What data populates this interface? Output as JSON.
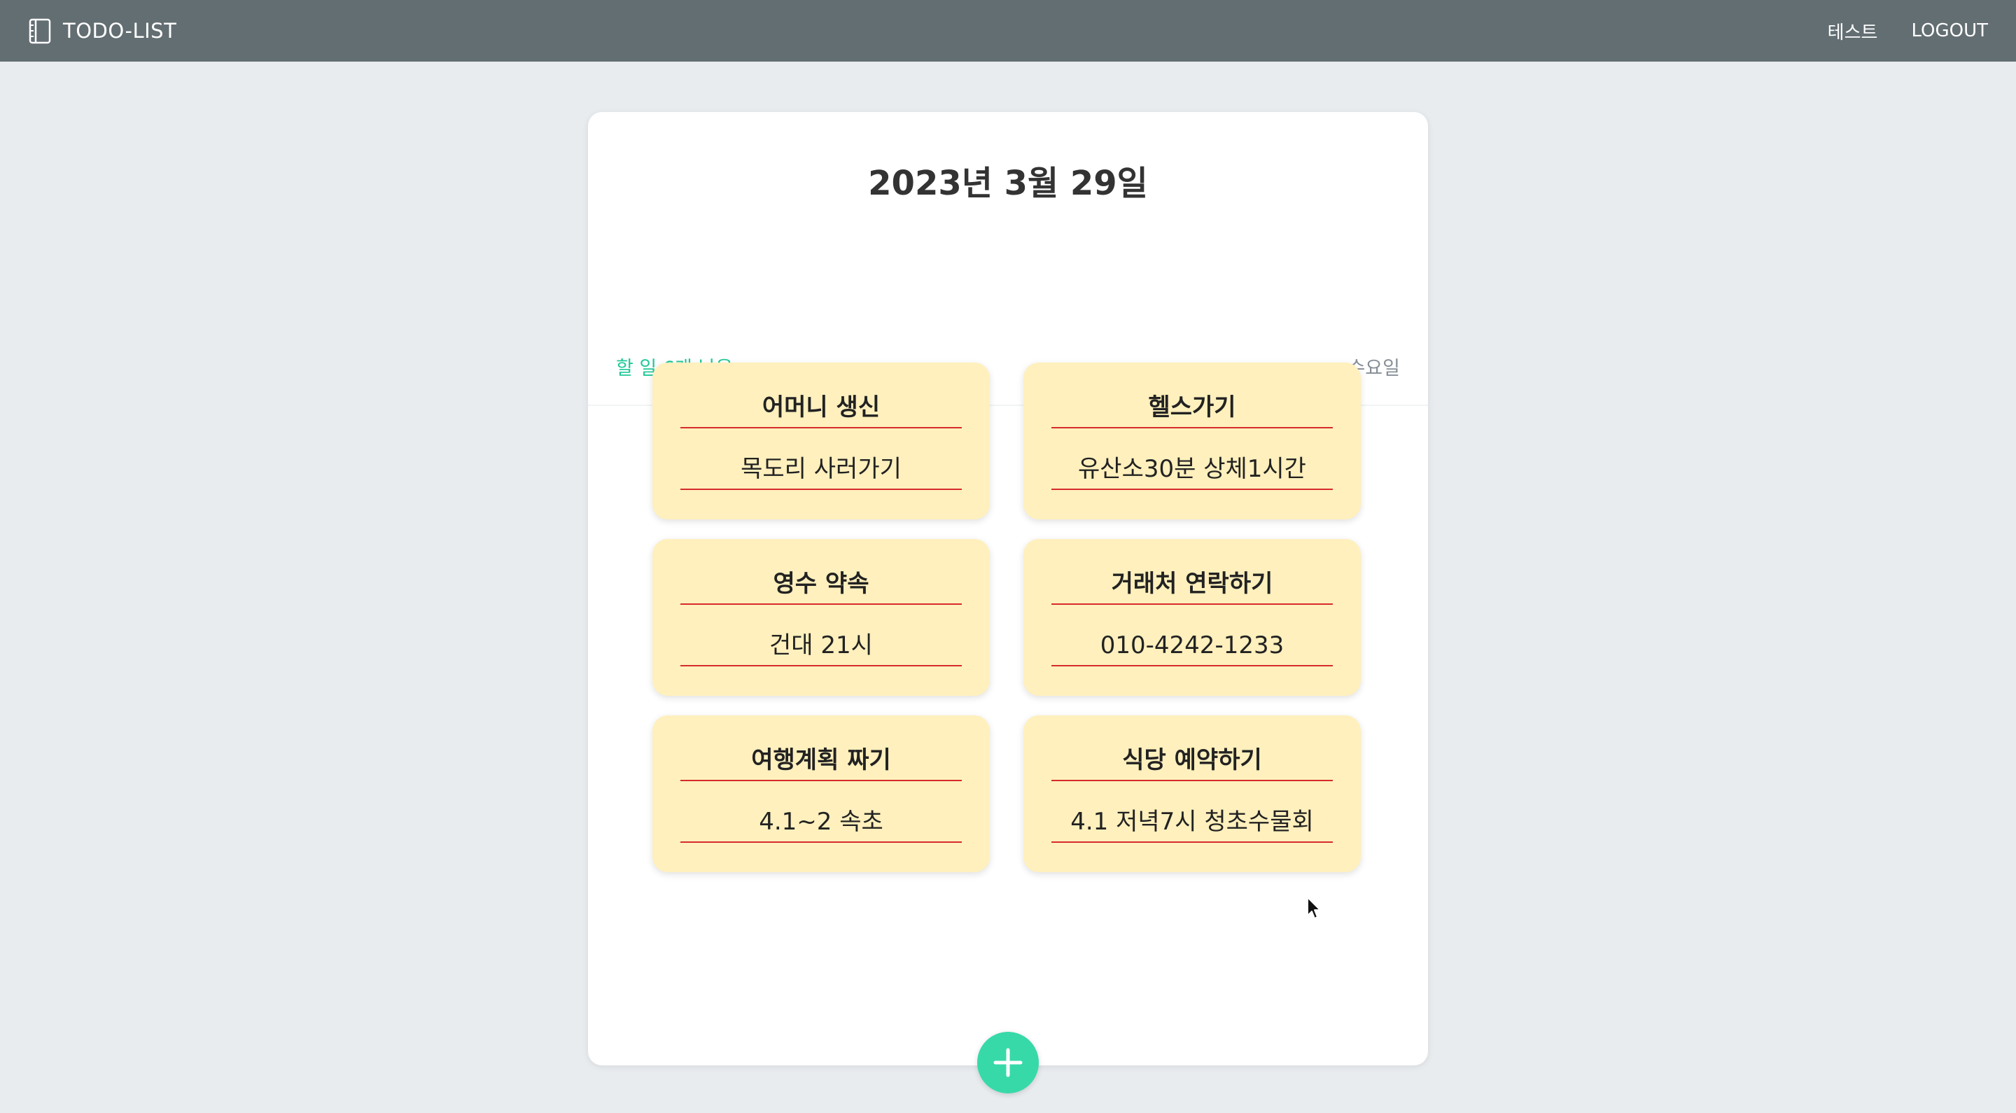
{
  "navbar": {
    "brand_icon": "notebook-icon",
    "brand_label": "TODO-LIST",
    "user_label": "테스트",
    "logout_label": "LOGOUT"
  },
  "header": {
    "date_title": "2023년 3월 29일",
    "remaining_text": "할 일 6개 남음",
    "day_of_week": "수요일"
  },
  "todos": [
    {
      "title": "어머니 생신",
      "description": "목도리 사러가기"
    },
    {
      "title": "헬스가기",
      "description": "유산소30분 상체1시간"
    },
    {
      "title": "영수 약속",
      "description": "건대 21시"
    },
    {
      "title": "거래처 연락하기",
      "description": "010-4242-1233"
    },
    {
      "title": "여행계획 짜기",
      "description": "4.1~2 속초"
    },
    {
      "title": "식당 예약하기",
      "description": "4.1 저녁7시 청초수물회"
    }
  ],
  "add_button": {
    "icon": "plus-icon"
  },
  "colors": {
    "navbar_bg": "#636e73",
    "page_bg": "#e8ecef",
    "accent": "#20c997",
    "add_button_bg": "#38d9a9",
    "card_bg": "#fff0bd",
    "card_underline": "#d62b2b"
  }
}
